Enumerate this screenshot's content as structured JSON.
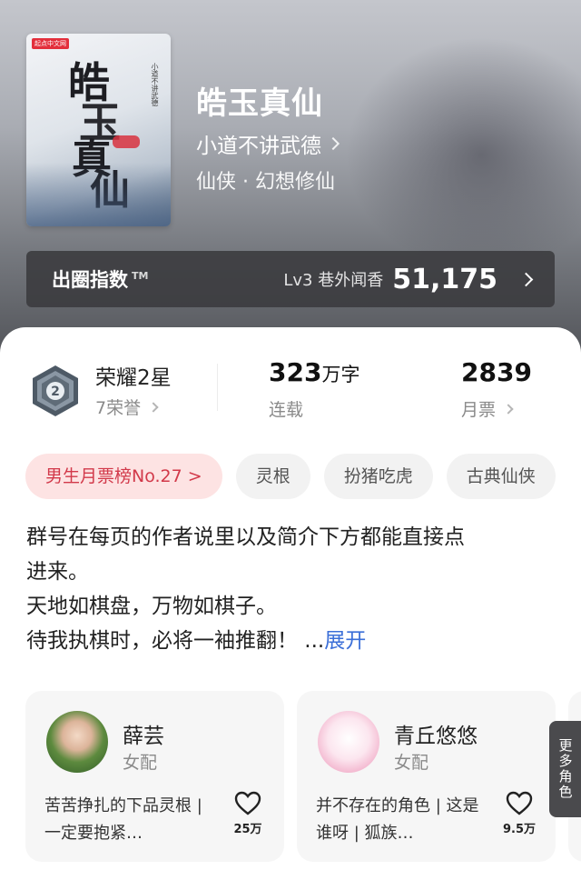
{
  "book": {
    "title": "皓玉真仙",
    "author": "小道不讲武德",
    "genre": "仙侠 · 幻想修仙",
    "cover": {
      "publisher_badge": "起点中文网",
      "title_chars": [
        "皓",
        "玉",
        "真",
        "仙"
      ],
      "author_vertical": "小道不讲武德"
    }
  },
  "popularity": {
    "label": "出圈指数",
    "tm": "TM",
    "level": "Lv3 巷外闻香",
    "value": "51,175"
  },
  "stats": {
    "honor": {
      "title": "荣耀2星",
      "sub": "7荣誉",
      "badge_number": "2"
    },
    "words": {
      "value": "323",
      "unit": "万字",
      "status": "连载"
    },
    "votes": {
      "value": "2839",
      "label": "月票"
    }
  },
  "tags": [
    "男生月票榜No.27 >",
    "灵根",
    "扮猪吃虎",
    "古典仙侠"
  ],
  "intro": {
    "lines": [
      "群号在每页的作者说里以及简介下方都能直接点",
      "进来。",
      "天地如棋盘，万物如棋子。",
      "待我执棋时，必将一袖推翻！ ..."
    ],
    "expand": "展开"
  },
  "characters": [
    {
      "name": "薛芸",
      "role": "女配",
      "desc": "苦苦挣扎的下品灵根 | 一定要抱紧…",
      "likes": "25万"
    },
    {
      "name": "青丘悠悠",
      "role": "女配",
      "desc": "并不存在的角色 | 这是谁呀 | 狐族…",
      "likes": "9.5万"
    }
  ],
  "more_roles": "更多角色",
  "colors": {
    "rank_tag_bg": "#fde3e3",
    "rank_tag_text": "#d2394a",
    "expand_link": "#3b6fd8",
    "popularity_bar": "#3a3a3e"
  },
  "icons": {
    "honor": "hexagon-badge-icon",
    "like": "heart-icon",
    "chevron": "chevron-right-icon"
  }
}
